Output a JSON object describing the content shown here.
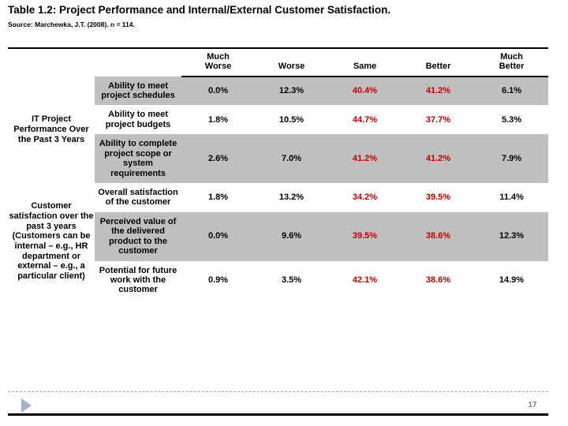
{
  "slide": {
    "title": "Table 1.2: Project Performance and Internal/External Customer Satisfaction.",
    "source": "Source: Marchewka, J.T. (2008). n = 114.",
    "page_number": "17",
    "highlight_color": "#C00000",
    "shade_color": "#BFBFBF",
    "triangle_color": "#9FB3CC"
  },
  "table": {
    "columns": [
      "",
      "",
      "Much Worse",
      "Worse",
      "Same",
      "Better",
      "Much Better"
    ],
    "headers": {
      "much_worse": "Much\nWorse",
      "much_worse_line1": "Much",
      "much_worse_line2": "Worse",
      "worse": "Worse",
      "same": "Same",
      "better": "Better",
      "much_better_line1": "Much",
      "much_better_line2": "Better"
    },
    "groups": [
      {
        "label": "IT Project Performance Over the Past 3 Years",
        "rows": [
          {
            "item": "Ability to meet project schedules",
            "shaded": true,
            "values": [
              "0.0%",
              "12.3%",
              "40.4%",
              "41.2%",
              "6.1%"
            ],
            "highlight": [
              false,
              false,
              true,
              true,
              false
            ]
          },
          {
            "item": "Ability to meet project budgets",
            "shaded": false,
            "values": [
              "1.8%",
              "10.5%",
              "44.7%",
              "37.7%",
              "5.3%"
            ],
            "highlight": [
              false,
              false,
              true,
              true,
              false
            ]
          },
          {
            "item": "Ability to complete project scope or system requirements",
            "shaded": true,
            "values": [
              "2.6%",
              "7.0%",
              "41.2%",
              "41.2%",
              "7.9%"
            ],
            "highlight": [
              false,
              false,
              true,
              true,
              false
            ]
          }
        ]
      },
      {
        "label": "Customer satisfaction over the past 3 years (Customers can be internal – e.g., HR department or external – e.g., a particular client)",
        "rows": [
          {
            "item": "Overall satisfaction of the customer",
            "shaded": false,
            "values": [
              "1.8%",
              "13.2%",
              "34.2%",
              "39.5%",
              "11.4%"
            ],
            "highlight": [
              false,
              false,
              true,
              true,
              false
            ]
          },
          {
            "item": "Perceived value of the delivered product to the customer",
            "shaded": true,
            "values": [
              "0.0%",
              "9.6%",
              "39.5%",
              "38.6%",
              "12.3%"
            ],
            "highlight": [
              false,
              false,
              true,
              true,
              false
            ]
          },
          {
            "item": "Potential for future work with the customer",
            "shaded": false,
            "values": [
              "0.9%",
              "3.5%",
              "42.1%",
              "38.6%",
              "14.9%"
            ],
            "highlight": [
              false,
              false,
              true,
              true,
              false
            ]
          }
        ]
      }
    ]
  },
  "chart_data": {
    "type": "table",
    "title": "Table 1.2: Project Performance and Internal/External Customer Satisfaction.",
    "subtitle": "Source: Marchewka, J.T. (2008). n = 114.",
    "categories": [
      "Much Worse",
      "Worse",
      "Same",
      "Better",
      "Much Better"
    ],
    "series": [
      {
        "name": "Ability to meet project schedules",
        "group": "IT Project Performance Over the Past 3 Years",
        "values": [
          0.0,
          12.3,
          40.4,
          41.2,
          6.1
        ]
      },
      {
        "name": "Ability to meet project budgets",
        "group": "IT Project Performance Over the Past 3 Years",
        "values": [
          1.8,
          10.5,
          44.7,
          37.7,
          5.3
        ]
      },
      {
        "name": "Ability to complete project scope or system requirements",
        "group": "IT Project Performance Over the Past 3 Years",
        "values": [
          2.6,
          7.0,
          41.2,
          41.2,
          7.9
        ]
      },
      {
        "name": "Overall satisfaction of the customer",
        "group": "Customer satisfaction over the past 3 years",
        "values": [
          1.8,
          13.2,
          34.2,
          39.5,
          11.4
        ]
      },
      {
        "name": "Perceived value of the delivered product to the customer",
        "group": "Customer satisfaction over the past 3 years",
        "values": [
          0.0,
          9.6,
          39.5,
          38.6,
          12.3
        ]
      },
      {
        "name": "Potential for future work with the customer",
        "group": "Customer satisfaction over the past 3 years",
        "values": [
          0.9,
          3.5,
          42.1,
          38.6,
          14.9
        ]
      }
    ],
    "units": "percent",
    "xlabel": "",
    "ylabel": "",
    "n": 114
  }
}
